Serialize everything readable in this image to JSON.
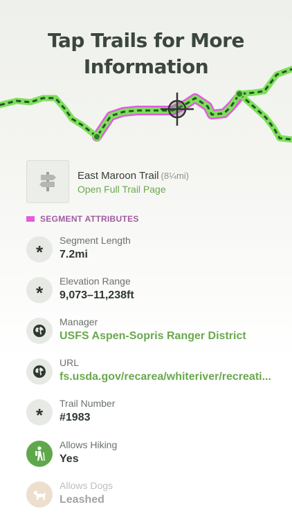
{
  "headline": {
    "line1": "Tap Trails for More",
    "line2": "Information"
  },
  "trail": {
    "name": "East Maroon Trail",
    "distance": "(8¼mi)",
    "link_label": "Open Full Trail Page"
  },
  "section": {
    "title": "SEGMENT ATTRIBUTES",
    "swatch_color": "#e15ce0"
  },
  "attributes": [
    {
      "label": "Segment Length",
      "value": "7.2mi",
      "icon": "asterisk-icon"
    },
    {
      "label": "Elevation Range",
      "value": "9,073–11,238ft",
      "icon": "asterisk-icon"
    },
    {
      "label": "Manager",
      "value": "USFS Aspen-Sopris Ranger District",
      "icon": "globe-icon",
      "is_link": true
    },
    {
      "label": "URL",
      "value": "fs.usda.gov/recarea/whiteriver/recreati...",
      "icon": "globe-icon",
      "is_link": true
    },
    {
      "label": "Trail Number",
      "value": "#1983",
      "icon": "asterisk-icon"
    },
    {
      "label": "Allows Hiking",
      "value": "Yes",
      "icon": "hiker-icon"
    },
    {
      "label": "Allows Dogs",
      "value": "Leashed",
      "icon": "dog-icon"
    }
  ],
  "colors": {
    "trail_green": "#7ee05a",
    "trail_dark": "#2e7d2a",
    "highlight_magenta": "#e15ce0",
    "link_green": "#6aa84f"
  }
}
